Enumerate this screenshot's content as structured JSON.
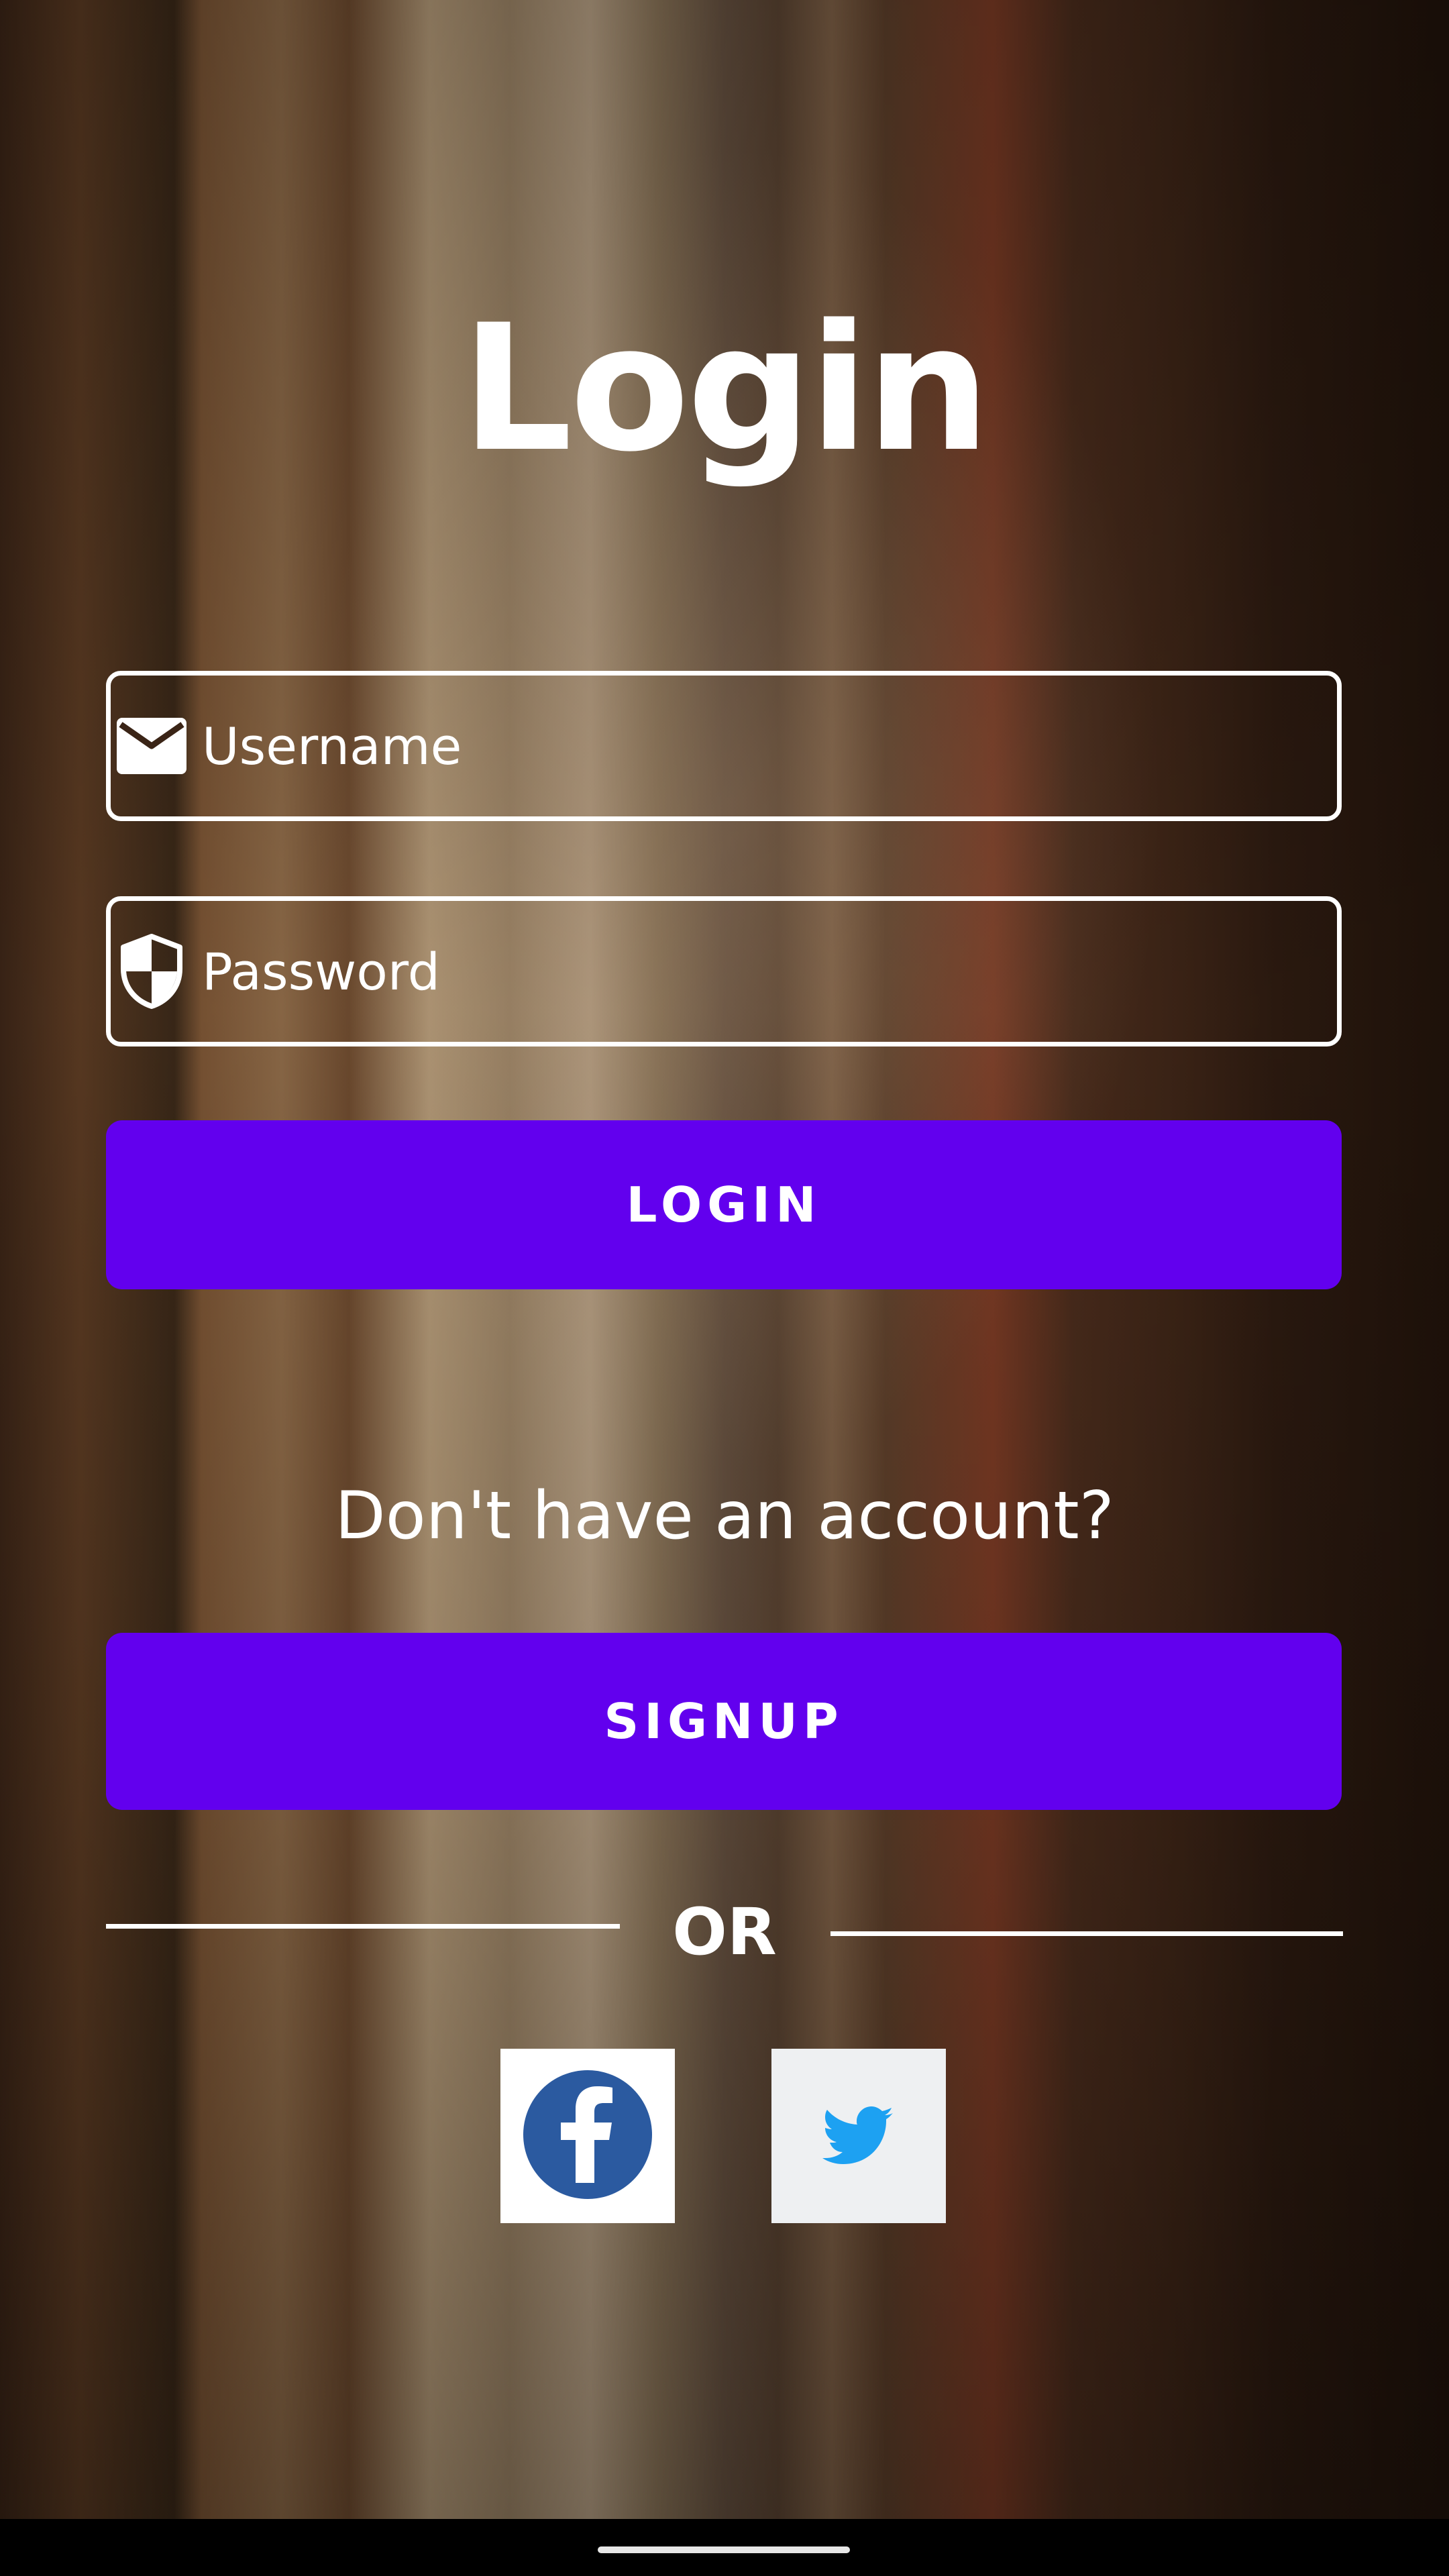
{
  "screen": {
    "title": "Login"
  },
  "form": {
    "username_placeholder": "Username",
    "password_placeholder": "Password",
    "login_label": "LOGIN",
    "signup_prompt": "Don't have an account?",
    "signup_label": "SIGNUP",
    "separator_label": "OR"
  },
  "social": {
    "facebook_icon": "facebook-logo-icon",
    "twitter_icon": "twitter-bird-icon"
  },
  "colors": {
    "accent": "#6200ee",
    "facebook": "#2b5aa0",
    "twitter": "#1da1f2"
  }
}
